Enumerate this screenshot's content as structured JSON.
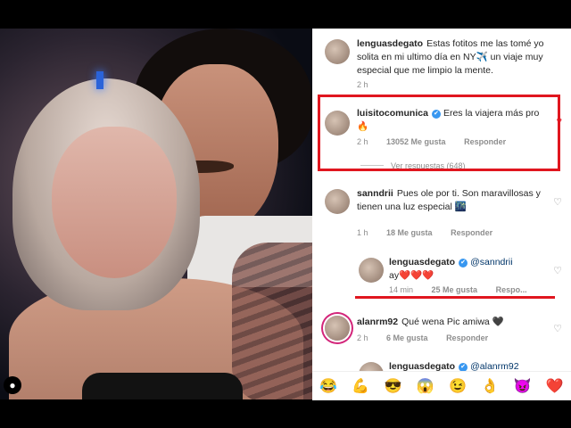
{
  "profile_button_icon": "person-icon",
  "comments": [
    {
      "user": "lenguasdegato",
      "text": "Estas fotitos me las tomé yo solita en mi ultimo día en NY",
      "emoji": "✈️",
      "text2": " un viaje muy especial que me limpio la mente.",
      "time": "2 h"
    },
    {
      "user": "luisitocomunica",
      "verified": "✔",
      "text": "Eres la viajera más pro",
      "emoji": "🔥",
      "time": "2 h",
      "likes": "13052 Me gusta",
      "reply": "Responder",
      "view_replies": "Ver respuestas (648)",
      "heart": "♥"
    },
    {
      "user": "sanndrii",
      "text": "Pues ole por ti. Son maravillosas y tienen una luz especial",
      "emoji": "🌃",
      "time": "1 h",
      "likes": "18 Me gusta",
      "reply": "Responder",
      "heart": "♡"
    },
    {
      "user": "lenguasdegato",
      "verified": "✔",
      "mention": "@sanndrii",
      "text": "ay",
      "emoji": "❤️❤️❤️",
      "time": "14 min",
      "likes": "25 Me gusta",
      "reply": "Respo...",
      "heart": "♡"
    },
    {
      "user": "alanrm92",
      "text": "Qué wena Pic amiwa",
      "emoji": "🖤",
      "time": "2 h",
      "likes": "6 Me gusta",
      "reply": "Responder",
      "heart": "♡"
    },
    {
      "user": "lenguasdegato",
      "verified": "✔",
      "mention": "@alanrm92"
    }
  ],
  "emoji_bar": [
    "😂",
    "💪",
    "😎",
    "😱",
    "😉",
    "👌",
    "😈",
    "❤️"
  ]
}
